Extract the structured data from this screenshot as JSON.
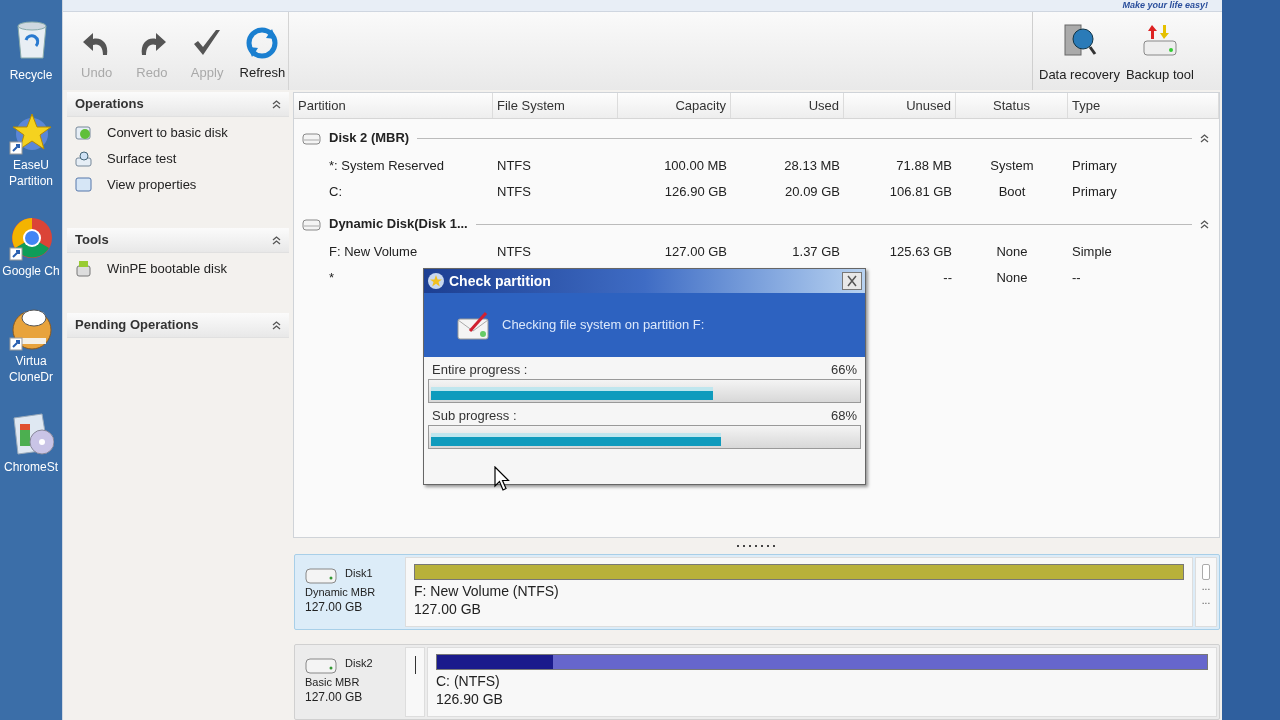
{
  "desktop_icons": [
    {
      "kind": "recycle",
      "lines": [
        "Recycle"
      ]
    },
    {
      "kind": "star",
      "lines": [
        "EaseU",
        "Partition"
      ]
    },
    {
      "kind": "chrome",
      "lines": [
        "Google Ch"
      ]
    },
    {
      "kind": "sheep",
      "lines": [
        "Virtua",
        "CloneDr"
      ]
    },
    {
      "kind": "box",
      "lines": [
        "ChromeSt"
      ]
    }
  ],
  "slogan": "Make your life easy!",
  "toolbar": [
    {
      "kind": "undo",
      "label": "Undo",
      "disabled": true
    },
    {
      "kind": "redo",
      "label": "Redo",
      "disabled": true
    },
    {
      "kind": "apply",
      "label": "Apply",
      "disabled": true
    },
    {
      "kind": "refresh",
      "label": "Refresh",
      "disabled": false
    }
  ],
  "toolbar_right": [
    {
      "kind": "recovery",
      "label": "Data recovery"
    },
    {
      "kind": "backup",
      "label": "Backup tool"
    }
  ],
  "sidebar": [
    {
      "title": "Operations",
      "items": [
        {
          "kind": "convert",
          "label": "Convert to basic disk"
        },
        {
          "kind": "surface",
          "label": "Surface test"
        },
        {
          "kind": "properties",
          "label": "View properties"
        }
      ]
    },
    {
      "title": "Tools",
      "items": [
        {
          "kind": "winpe",
          "label": "WinPE bootable disk"
        }
      ]
    },
    {
      "title": "Pending Operations"
    }
  ],
  "table": {
    "columns": [
      "Partition",
      "File System",
      "Capacity",
      "Used",
      "Unused",
      "Status",
      "Type"
    ],
    "groups": [
      {
        "title": "Disk 2 (MBR)",
        "rows": [
          {
            "partition": "*: System Reserved",
            "file_system": "NTFS",
            "capacity": "100.00 MB",
            "used": "28.13 MB",
            "unused": "71.88 MB",
            "status": "System",
            "type": "Primary"
          },
          {
            "partition": "C:",
            "file_system": "NTFS",
            "capacity": "126.90 GB",
            "used": "20.09 GB",
            "unused": "106.81 GB",
            "status": "Boot",
            "type": "Primary"
          }
        ]
      },
      {
        "title": "Dynamic Disk(Disk 1...",
        "rows": [
          {
            "partition": "F: New Volume",
            "file_system": "NTFS",
            "capacity": "127.00 GB",
            "used": "1.37 GB",
            "unused": "125.63 GB",
            "status": "None",
            "type": "Simple"
          },
          {
            "partition": "*",
            "unused": "--",
            "status": "None",
            "type": "--"
          }
        ]
      }
    ]
  },
  "dialog": {
    "title": "Check partition",
    "message": "Checking file system on partition F:",
    "progress": [
      {
        "label": "Entire progress :",
        "reading": "66%",
        "level": 0.66
      },
      {
        "label": "Sub progress :",
        "reading": "68%",
        "level": 0.68
      }
    ]
  },
  "disks": [
    {
      "name": "Disk1",
      "type": "Dynamic MBR",
      "size": "127.00 GB",
      "selected": true,
      "partitions": [
        {
          "kind": "volume",
          "label": "F: New Volume (NTFS)",
          "size": "127.00 GB",
          "color": "#b8b13a"
        },
        {
          "kind": "unallocated",
          "marks": [
            "...",
            "..."
          ]
        }
      ]
    },
    {
      "name": "Disk2",
      "type": "Basic MBR",
      "size": "127.00 GB",
      "selected": false,
      "partitions": [
        {
          "kind": "sliver"
        },
        {
          "kind": "volume",
          "label": "C: (NTFS)",
          "size": "126.90 GB",
          "color": "#1a1a8c",
          "level": 0.15
        }
      ]
    }
  ]
}
